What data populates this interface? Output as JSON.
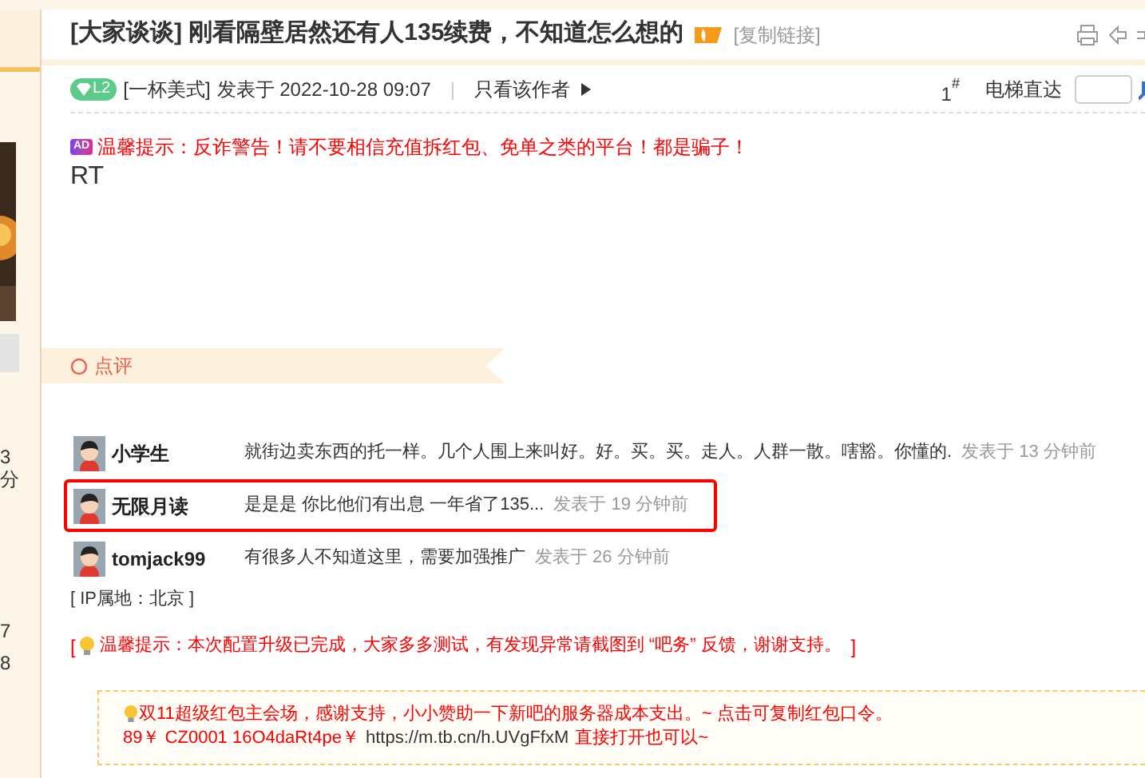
{
  "sidebar": {
    "texts": [
      "3",
      "分",
      "7",
      "8"
    ]
  },
  "thread": {
    "title": "[大家谈谈] 刚看隔壁居然还有人135续费，不知道怎么想的",
    "copy_link": "[复制链接]"
  },
  "post": {
    "level_badge": "L2",
    "author": "[一杯美式]",
    "posted": "发表于 2022-10-28 09:07",
    "separator": "|",
    "only_author": "只看该作者",
    "floor": "1",
    "floor_mark": "#",
    "jump_label": "电梯直达",
    "ad_badge": "AD",
    "notice": "温馨提示：反诈警告！请不要相信充值拆红包、免单之类的平台！都是骗子！",
    "body": "RT"
  },
  "comments_header": "点评",
  "comments": [
    {
      "user": "小学生",
      "text": "就街边卖东西的托一样。几个人围上来叫好。好。买。买。走人。人群一散。嗐豁。你懂的.",
      "time": "发表于 13 分钟前",
      "highlighted": false
    },
    {
      "user": "无限月读",
      "text": "是是是 你比他们有出息 一年省了135...",
      "time": "发表于 19 分钟前",
      "highlighted": true
    },
    {
      "user": "tomjack99",
      "text": "有很多人不知道这里，需要加强推广",
      "time": "发表于 26 分钟前",
      "highlighted": false
    }
  ],
  "ip_location": "[ IP属地：北京 ]",
  "system_notice": {
    "open": "[",
    "text": "温馨提示：本次配置升级已完成，大家多多测试，有发现异常请截图到 “吧务” 反馈，谢谢支持。",
    "close": "]"
  },
  "promo": {
    "line1": "双11超级红包主会场，感谢支持，小小赞助一下新吧的服务器成本支出。~ 点击可复制红包口令。",
    "code": "89￥ CZ0001 16O4daRt4pe￥",
    "url": "https://m.tb.cn/h.UVgFfxM",
    "suffix": "直接打开也可以~"
  }
}
